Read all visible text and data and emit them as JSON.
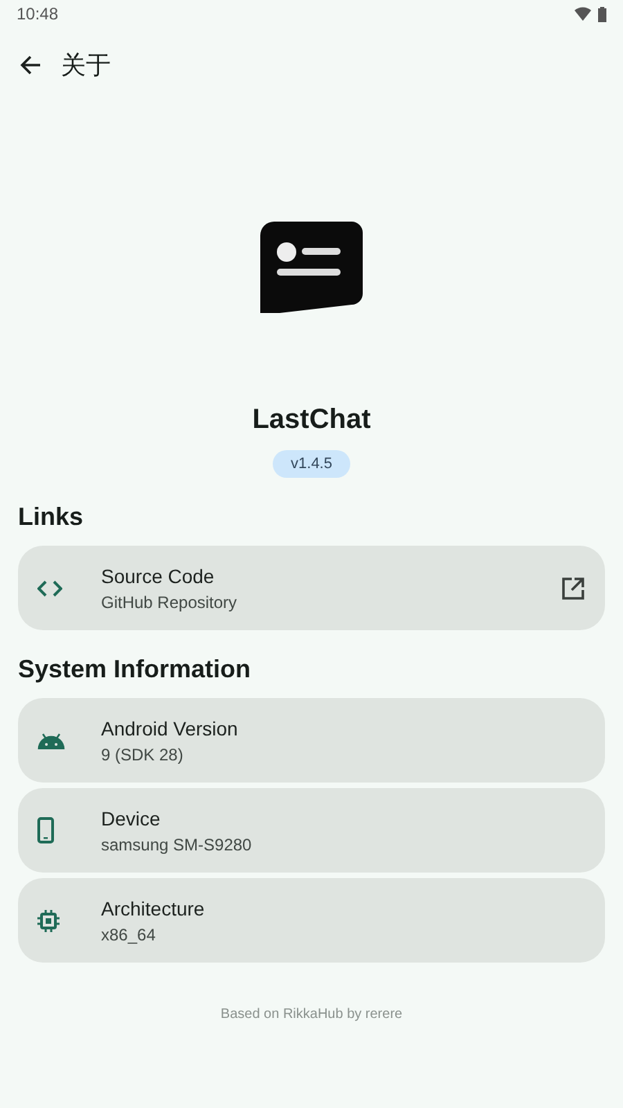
{
  "status_bar": {
    "time": "10:48"
  },
  "top_bar": {
    "title": "关于"
  },
  "app": {
    "name": "LastChat",
    "version": "v1.4.5"
  },
  "sections": [
    {
      "title": "Links",
      "items": [
        {
          "kind": "link",
          "title": "Source Code",
          "subtitle": "GitHub Repository"
        }
      ]
    },
    {
      "title": "System Information",
      "items": [
        {
          "kind": "info",
          "title": "Android Version",
          "subtitle": "9 (SDK 28)"
        },
        {
          "kind": "info",
          "title": "Device",
          "subtitle": "samsung SM-S9280"
        },
        {
          "kind": "info",
          "title": "Architecture",
          "subtitle": "x86_64"
        }
      ]
    }
  ],
  "footer": "Based on RikkaHub by rerere"
}
